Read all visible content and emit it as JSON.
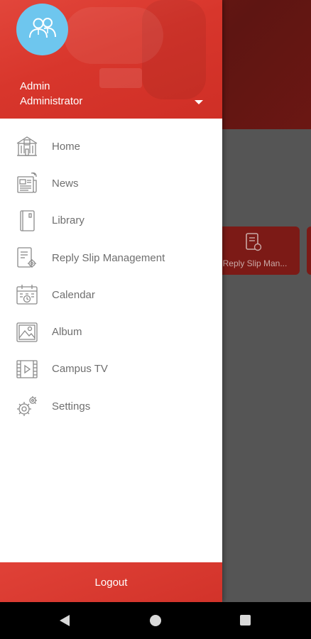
{
  "background": {
    "tile_label": "Reply Slip Man..."
  },
  "drawer": {
    "user": {
      "name": "Admin",
      "role": "Administrator",
      "avatar_icon": "users-icon"
    },
    "menu": [
      {
        "label": "Home",
        "icon": "school-building-icon"
      },
      {
        "label": "News",
        "icon": "news-icon"
      },
      {
        "label": "Library",
        "icon": "book-icon"
      },
      {
        "label": "Reply Slip Management",
        "icon": "reply-slip-icon"
      },
      {
        "label": "Calendar",
        "icon": "calendar-icon"
      },
      {
        "label": "Album",
        "icon": "album-icon"
      },
      {
        "label": "Campus TV",
        "icon": "campus-tv-icon"
      },
      {
        "label": "Settings",
        "icon": "gear-icon"
      }
    ],
    "logout_label": "Logout"
  },
  "colors": {
    "accent": "#d8362c",
    "avatar": "#6ec6ee",
    "menu_text": "#6f6f6f"
  }
}
